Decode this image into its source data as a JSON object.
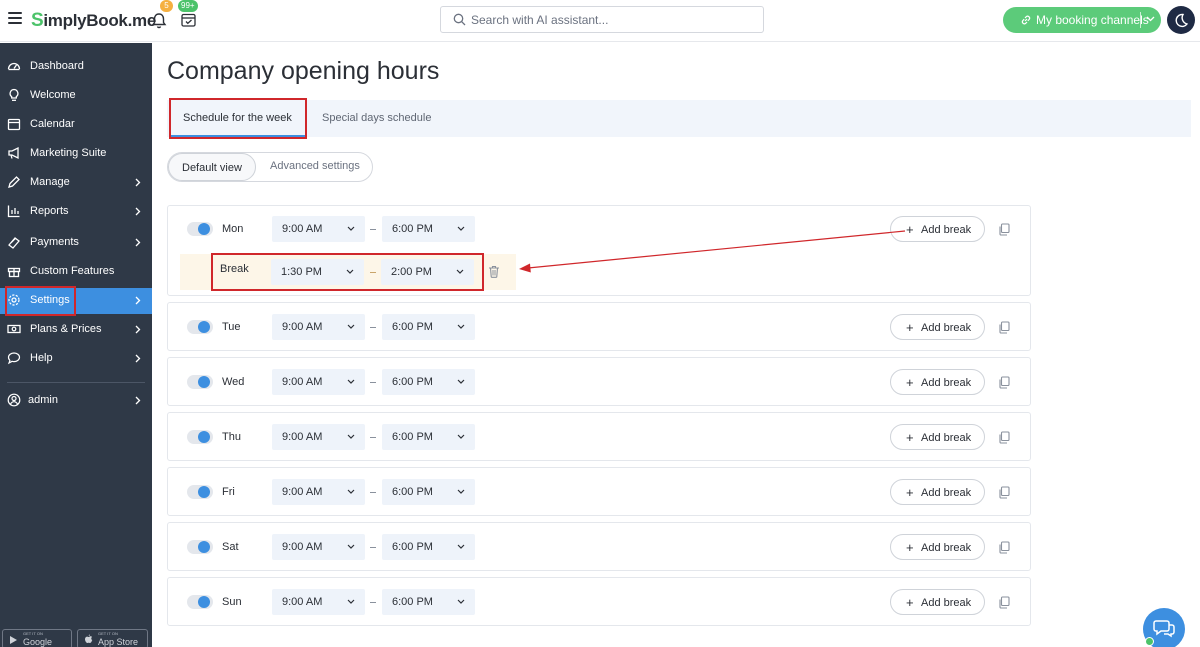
{
  "header": {
    "logo_rest": "implyBook.me",
    "logo_s": "S",
    "notifications_count": "5",
    "bookings_count": "99+",
    "search_placeholder": "Search with AI assistant...",
    "channels_label": "My booking channels"
  },
  "sidebar": {
    "items": [
      {
        "label": "Dashboard",
        "icon": "dashboard-icon"
      },
      {
        "label": "Welcome",
        "icon": "lightbulb-icon"
      },
      {
        "label": "Calendar",
        "icon": "calendar-icon"
      },
      {
        "label": "Marketing Suite",
        "icon": "megaphone-icon"
      },
      {
        "label": "Manage",
        "icon": "pencil-icon"
      },
      {
        "label": "Reports",
        "icon": "chart-icon"
      },
      {
        "label": "Payments",
        "icon": "payments-icon"
      },
      {
        "label": "Custom Features",
        "icon": "gift-icon"
      },
      {
        "label": "Settings",
        "icon": "gear-icon"
      },
      {
        "label": "Plans & Prices",
        "icon": "money-icon"
      },
      {
        "label": "Help",
        "icon": "chat-bubble-icon"
      }
    ],
    "admin_label": "admin",
    "google_small": "GET IT ON",
    "google_big": "Google Play",
    "apple_small": "GET IT ON",
    "apple_big": "App Store"
  },
  "page": {
    "title": "Company opening hours",
    "tab_week": "Schedule for the week",
    "tab_special": "Special days schedule",
    "view_default": "Default view",
    "view_advanced": "Advanced settings",
    "add_break_label": "Add break",
    "break_label": "Break",
    "break_start": "1:30 PM",
    "break_end": "2:00 PM"
  },
  "days": [
    {
      "day": "Mon",
      "start": "9:00 AM",
      "end": "6:00 PM",
      "enabled": true
    },
    {
      "day": "Tue",
      "start": "9:00 AM",
      "end": "6:00 PM",
      "enabled": true
    },
    {
      "day": "Wed",
      "start": "9:00 AM",
      "end": "6:00 PM",
      "enabled": true
    },
    {
      "day": "Thu",
      "start": "9:00 AM",
      "end": "6:00 PM",
      "enabled": true
    },
    {
      "day": "Fri",
      "start": "9:00 AM",
      "end": "6:00 PM",
      "enabled": true
    },
    {
      "day": "Sat",
      "start": "9:00 AM",
      "end": "6:00 PM",
      "enabled": true
    },
    {
      "day": "Sun",
      "start": "9:00 AM",
      "end": "6:00 PM",
      "enabled": true
    }
  ],
  "colors": {
    "sidebar_bg": "#2f3947",
    "active": "#3d8fe0",
    "brand_green": "#4cc36a",
    "highlight_red": "#d0272b",
    "break_bg": "#fdf6e8"
  }
}
